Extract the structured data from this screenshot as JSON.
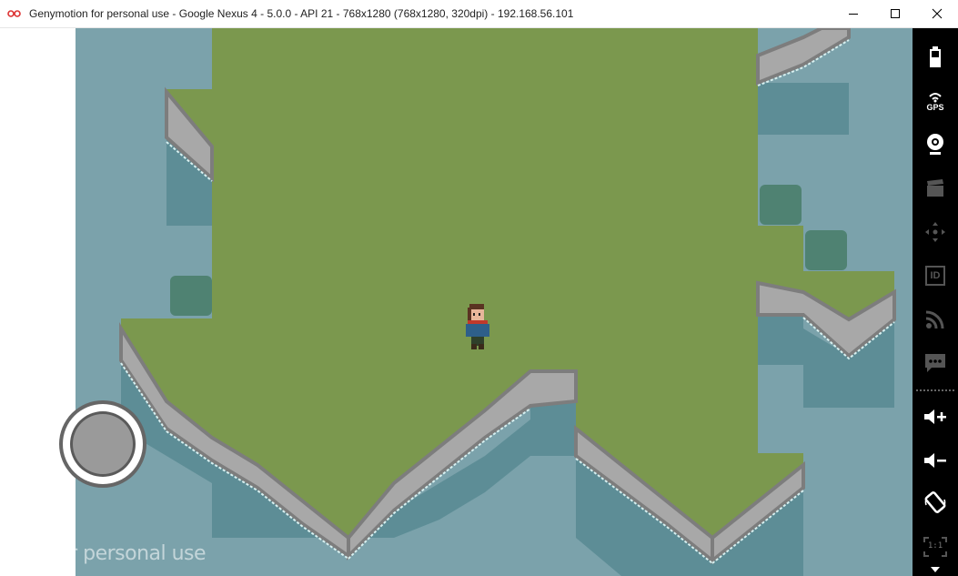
{
  "window": {
    "title": "Genymotion for personal use - Google Nexus 4 - 5.0.0 - API 21 - 768x1280 (768x1280, 320dpi) - 192.168.56.101",
    "controls": [
      "minimize-icon",
      "maximize-icon",
      "close-icon"
    ]
  },
  "game": {
    "watermark": "free for personal use",
    "character": "player-character",
    "joystick": "virtual-joystick"
  },
  "sidebar": {
    "buttons": [
      {
        "name": "battery-button",
        "icon": "battery-icon",
        "label": ""
      },
      {
        "name": "gps-button",
        "icon": "gps-icon",
        "label": "GPS"
      },
      {
        "name": "webcam-button",
        "icon": "webcam-icon",
        "label": ""
      },
      {
        "name": "capture-button",
        "icon": "clapperboard-icon",
        "label": ""
      },
      {
        "name": "remote-control-button",
        "icon": "dpad-icon",
        "label": ""
      },
      {
        "name": "device-id-button",
        "icon": "id-icon",
        "label": "ID"
      },
      {
        "name": "network-button",
        "icon": "rss-icon",
        "label": ""
      },
      {
        "name": "sms-button",
        "icon": "message-icon",
        "label": ""
      },
      {
        "name": "volume-up-button",
        "icon": "volume-up-icon",
        "label": ""
      },
      {
        "name": "volume-down-button",
        "icon": "volume-down-icon",
        "label": ""
      },
      {
        "name": "rotate-button",
        "icon": "rotate-icon",
        "label": ""
      },
      {
        "name": "pixel-perfect-button",
        "icon": "fullscreen-icon",
        "label": "1:1"
      }
    ]
  },
  "colors": {
    "water": "#7ba2ab",
    "water_deep": "#5d8d96",
    "grass": "#7b984e",
    "rock": "#a8a8a8",
    "rock_dark": "#7d7d7d",
    "foam": "#d8f0f0",
    "sidebar_bg": "#000000",
    "sidebar_icon": "#ffffff",
    "sidebar_icon_disabled": "#555555"
  }
}
